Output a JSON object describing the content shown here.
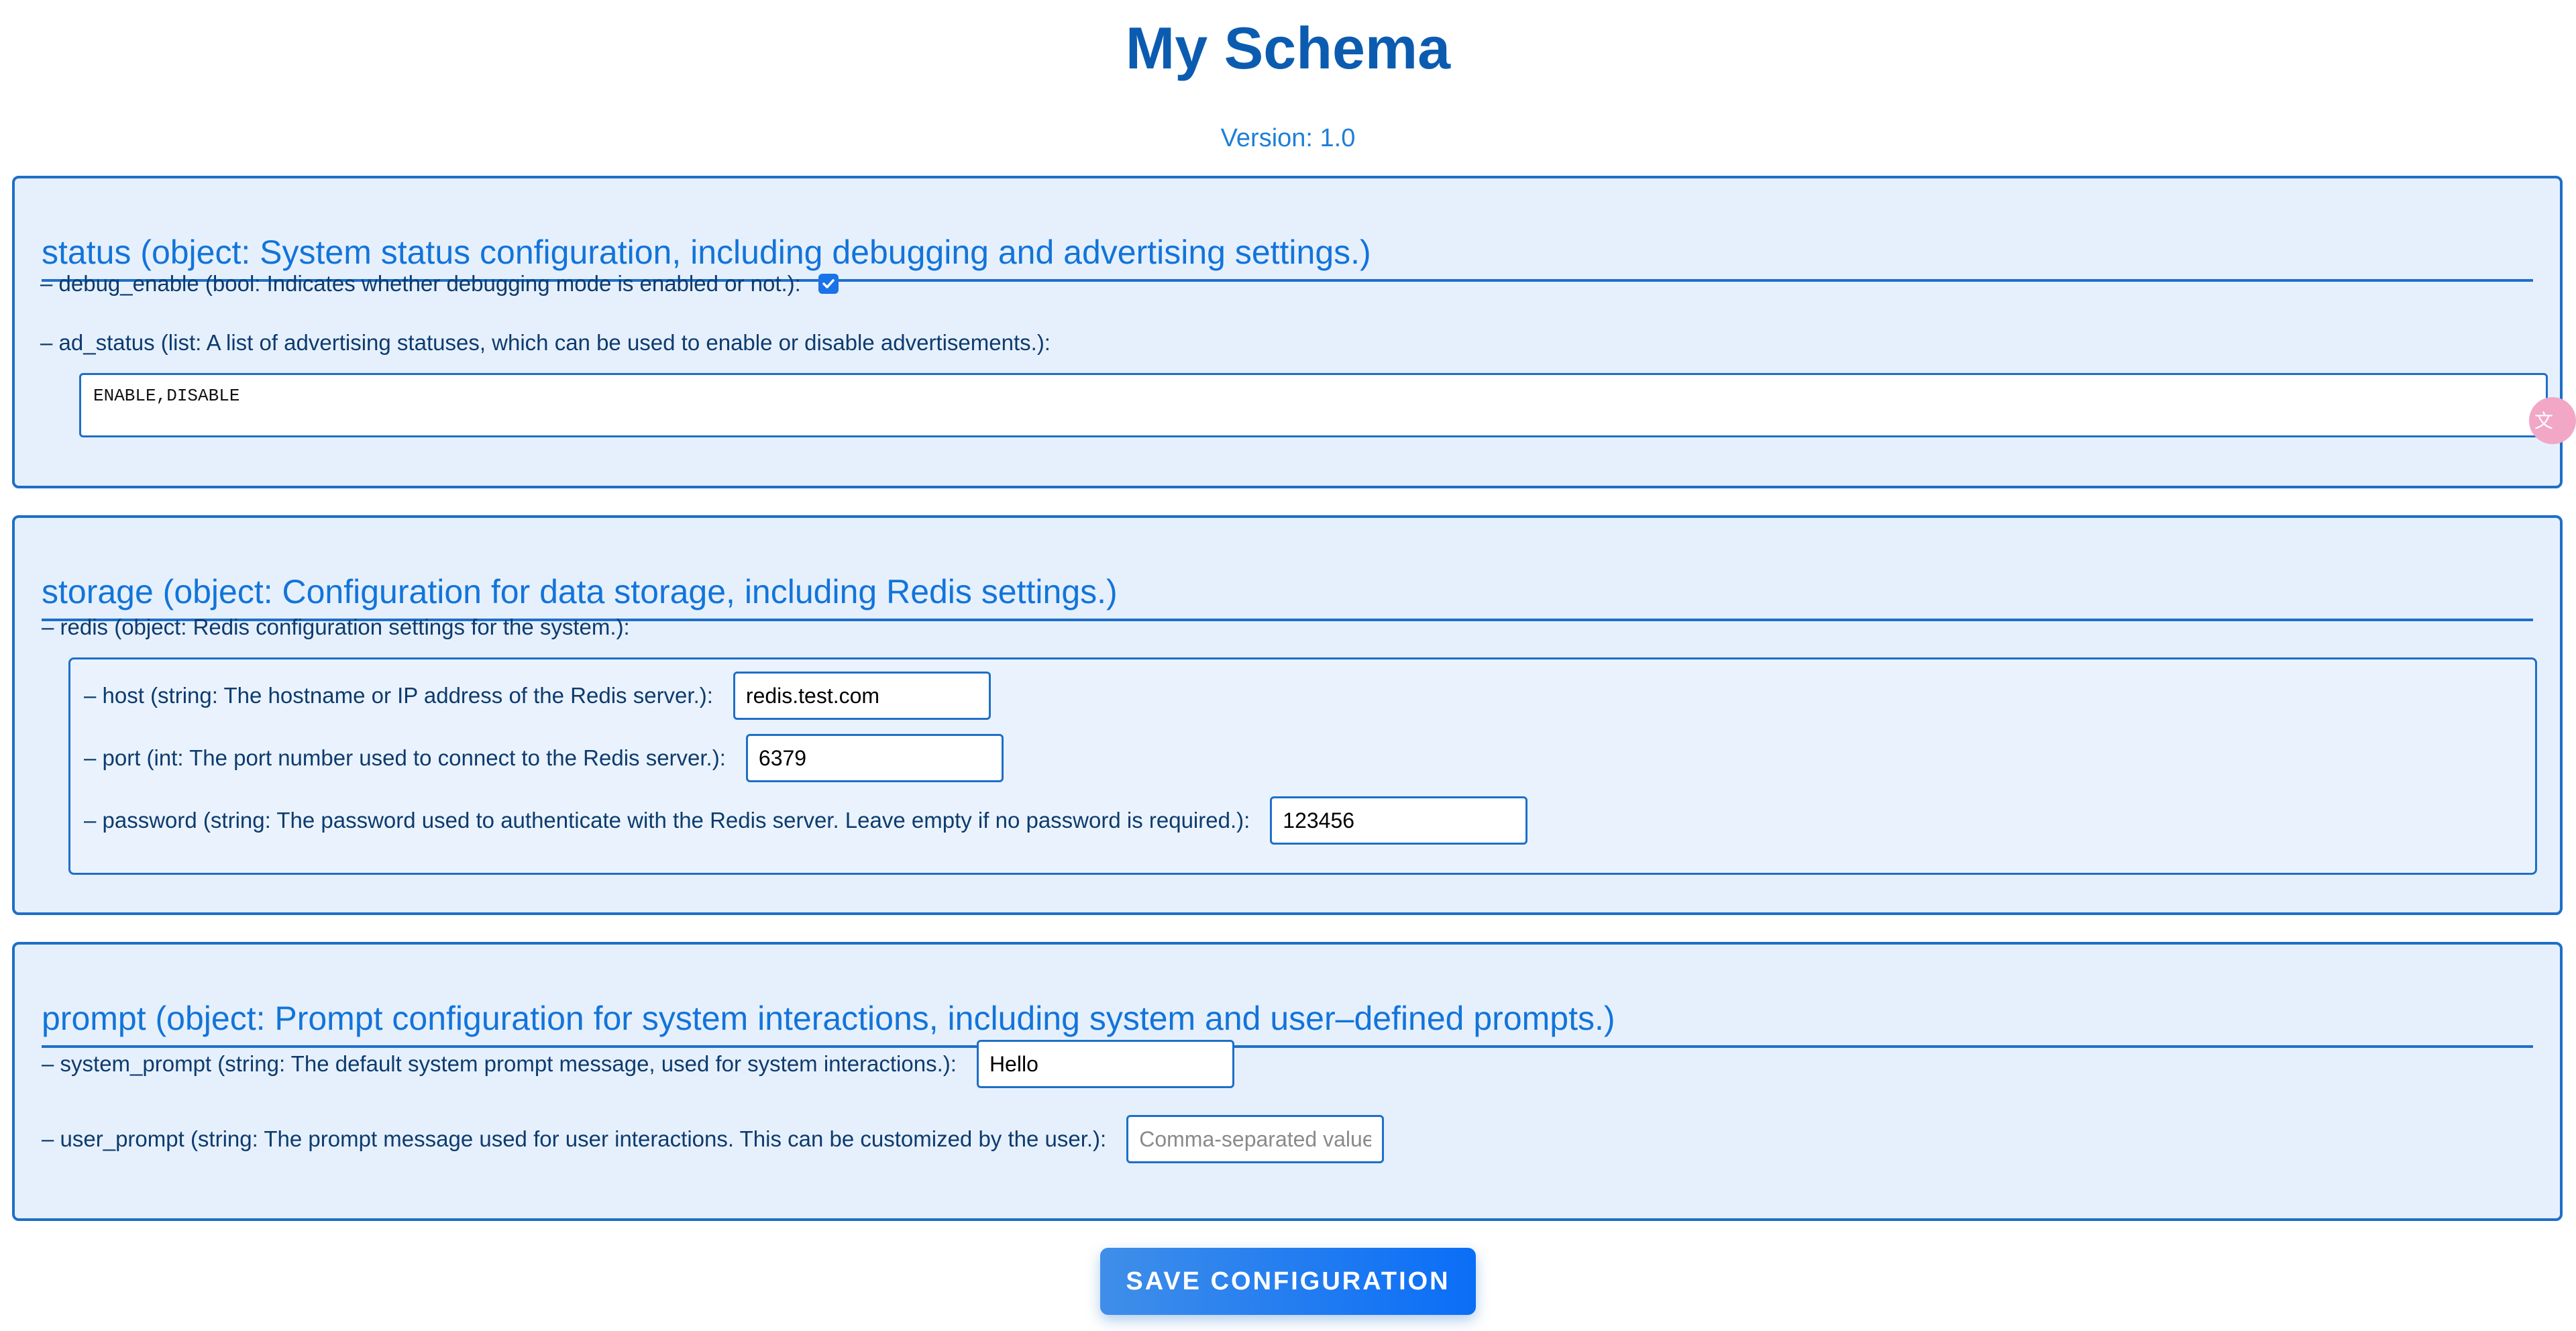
{
  "header": {
    "title": "My Schema",
    "version": "Version: 1.0"
  },
  "sections": {
    "status": {
      "title": "status (object: System status configuration, including debugging and advertising settings.)",
      "debug_enable": {
        "label": "– debug_enable (bool: Indicates whether debugging mode is enabled or not.):",
        "checked": true
      },
      "ad_status": {
        "label": "– ad_status (list: A list of advertising statuses, which can be used to enable or disable advertisements.):",
        "value": "ENABLE,DISABLE"
      }
    },
    "storage": {
      "title": "storage (object: Configuration for data storage, including Redis settings.)",
      "redis": {
        "label": "– redis (object: Redis configuration settings for the system.):",
        "host": {
          "label": "– host (string: The hostname or IP address of the Redis server.):",
          "value": "redis.test.com"
        },
        "port": {
          "label": "– port (int: The port number used to connect to the Redis server.):",
          "value": "6379"
        },
        "password": {
          "label": "– password (string: The password used to authenticate with the Redis server. Leave empty if no password is required.):",
          "value": "123456"
        }
      }
    },
    "prompt": {
      "title": "prompt (object: Prompt configuration for system interactions, including system and user–defined prompts.)",
      "system_prompt": {
        "label": "– system_prompt (string: The default system prompt message, used for system interactions.):",
        "value": "Hello"
      },
      "user_prompt": {
        "label": "– user_prompt (string: The prompt message used for user interactions. This can be customized by the user.):",
        "value": "",
        "placeholder": "Comma-separated values"
      }
    }
  },
  "save_button": "SAVE CONFIGURATION",
  "colors": {
    "accent": "#1274da",
    "border": "#1e6fc8",
    "section_bg": "#e6f0fc",
    "button_start": "#3f8ee9",
    "button_end": "#0a6ef7"
  },
  "icons": {
    "floating": "translate-icon"
  }
}
